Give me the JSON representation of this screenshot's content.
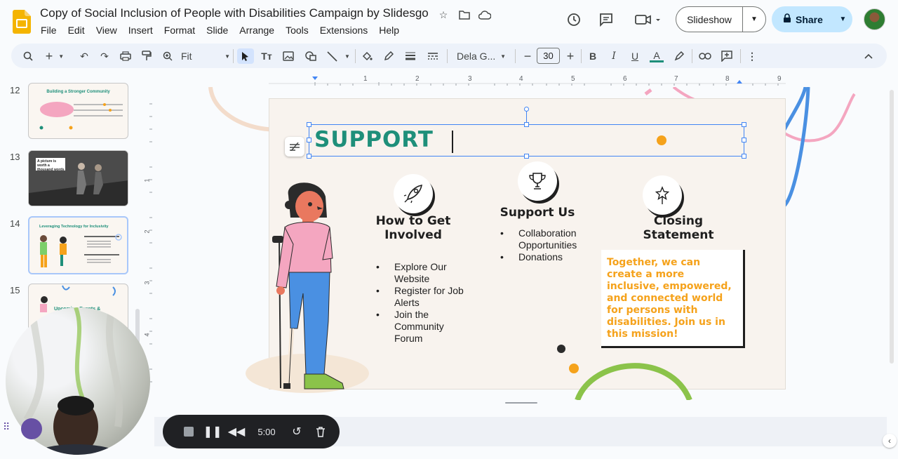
{
  "app": {
    "doc_title": "Copy of Social Inclusion of People with Disabilities Campaign by Slidesgo",
    "menu": [
      "File",
      "Edit",
      "View",
      "Insert",
      "Format",
      "Slide",
      "Arrange",
      "Tools",
      "Extensions",
      "Help"
    ],
    "slideshow_label": "Slideshow",
    "share_label": "Share"
  },
  "toolbar": {
    "zoom": "Fit",
    "font": "Dela G...",
    "font_size": "30"
  },
  "filmstrip": {
    "slides": [
      {
        "num": "12",
        "title": "Building a Stronger Community"
      },
      {
        "num": "13",
        "title": "A picture is worth a thousand words"
      },
      {
        "num": "14",
        "title": "Leveraging Technology for Inclusivity"
      },
      {
        "num": "15",
        "title": "Upcoming Events &"
      }
    ]
  },
  "ruler": {
    "h_ticks": [
      "1",
      "2",
      "3",
      "4",
      "5",
      "6",
      "7",
      "8",
      "9"
    ],
    "v_ticks": [
      "1",
      "2",
      "3",
      "4"
    ]
  },
  "slide": {
    "title_text": "SUPPORT",
    "col1": {
      "heading": "How to Get Involved",
      "bullets": [
        "Explore Our Website",
        "Register for Job Alerts",
        "Join the Community Forum"
      ]
    },
    "col2": {
      "heading": "Support Us",
      "bullets": [
        "Collaboration Opportunities",
        "Donations"
      ]
    },
    "col3": {
      "heading": "Closing Statement",
      "text": "Together, we can create a more inclusive, empowered, and connected world for persons with disabilities. Join us in this mission!"
    }
  },
  "recorder": {
    "time": "5:00"
  },
  "colors": {
    "accent_teal": "#1e8f7a",
    "accent_orange": "#f5a21b",
    "share_bg": "#c2e7ff",
    "selection_blue": "#4285f4"
  }
}
